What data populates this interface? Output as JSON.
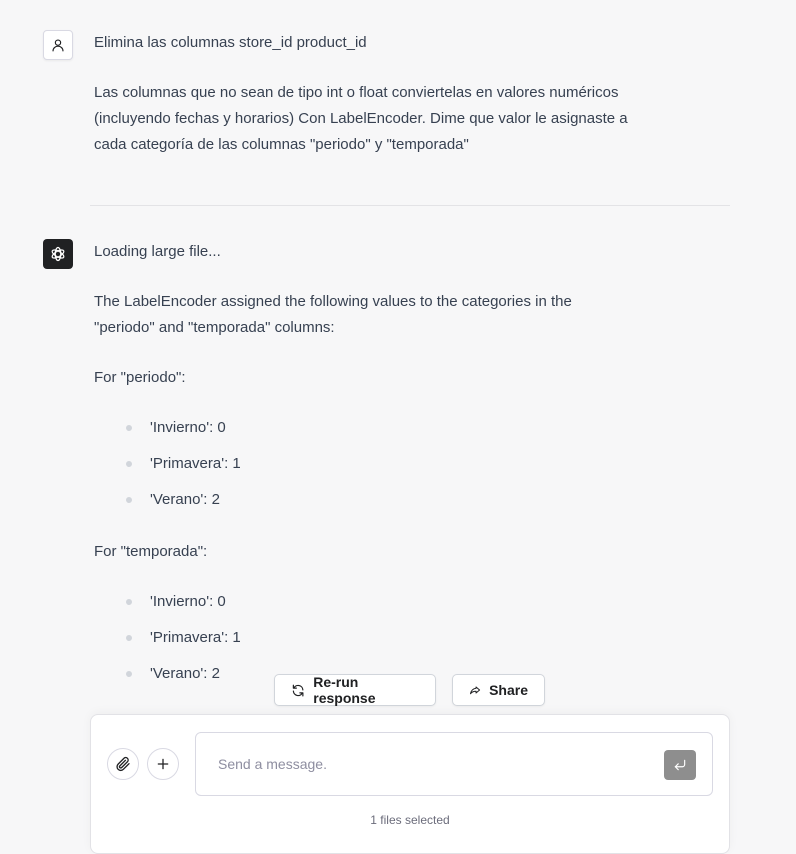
{
  "conversation": {
    "user_message": {
      "line1": "Elimina las columnas store_id product_id",
      "paragraph": "Las columnas que no sean de tipo int o float conviertelas en valores numéricos (incluyendo fechas y horarios) Con LabelEncoder. Dime que valor le asignaste a cada categoría de las columnas \"periodo\" y \"temporada\""
    },
    "assistant_message": {
      "status": "Loading large file...",
      "intro": "The LabelEncoder assigned the following values to the categories in the \"periodo\" and \"temporada\" columns:",
      "sections": [
        {
          "heading": "For \"periodo\":",
          "items": [
            "'Invierno': 0",
            "'Primavera': 1",
            "'Verano': 2"
          ]
        },
        {
          "heading": "For \"temporada\":",
          "items": [
            "'Invierno': 0",
            "'Primavera': 1",
            "'Verano': 2"
          ]
        }
      ]
    }
  },
  "actions": {
    "rerun_label": "Re-run response",
    "share_label": "Share"
  },
  "composer": {
    "placeholder": "Send a message.",
    "files_status": "1 files selected"
  },
  "icons": {
    "user_avatar": "person-icon",
    "assistant_avatar": "openai-logo-icon",
    "rerun": "refresh-icon",
    "share": "share-arrow-icon",
    "attach": "paperclip-icon",
    "add": "plus-icon",
    "send": "enter-icon"
  },
  "colors": {
    "background": "#f7f7f8",
    "assistant_avatar_bg": "#202123",
    "send_button_bg": "#8e8e8e",
    "text": "#374151"
  }
}
